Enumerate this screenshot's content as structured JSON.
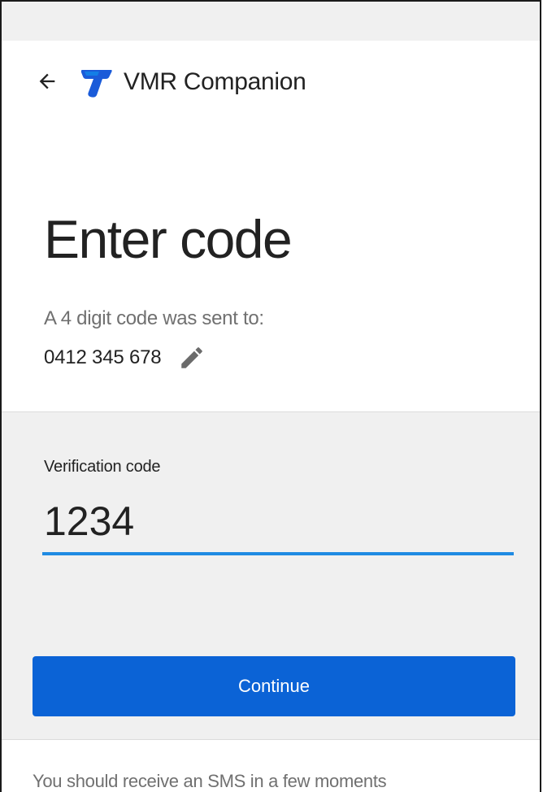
{
  "header": {
    "back_icon": "arrow-left-icon",
    "logo_icon": "telstra-t-logo",
    "app_title": "VMR Companion"
  },
  "main": {
    "heading": "Enter code",
    "sent_label": "A 4 digit code was sent to:",
    "phone_number": "0412 345 678",
    "edit_icon": "pencil-icon"
  },
  "form": {
    "field_label": "Verification code",
    "code_value": "1234",
    "continue_label": "Continue"
  },
  "footer": {
    "note": "You should receive an SMS in a few moments"
  },
  "colors": {
    "accent_blue": "#0b63d6",
    "input_underline": "#1f8be3",
    "section_gray": "#f0f0f0"
  }
}
